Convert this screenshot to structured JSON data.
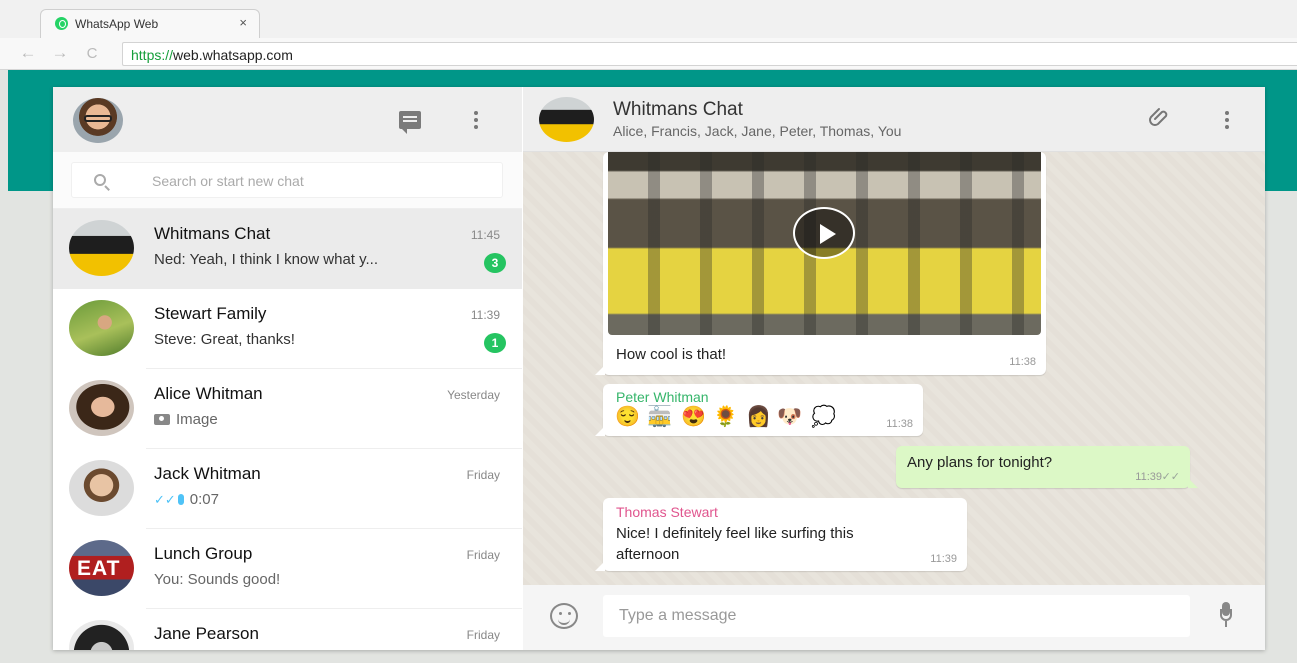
{
  "browser": {
    "tab_title": "WhatsApp Web",
    "tab_close": "×",
    "back_glyph": "←",
    "forward_glyph": "→",
    "reload_glyph": "C",
    "url_scheme": "https://",
    "url_rest": "web.whatsapp.com"
  },
  "search": {
    "placeholder": "Search or start new chat"
  },
  "chats": [
    {
      "name": "Whitmans Chat",
      "time": "11:45",
      "last": "Ned: Yeah, I think I know what y...",
      "unread": "3"
    },
    {
      "name": "Stewart Family",
      "time": "11:39",
      "last": "Steve: Great, thanks!",
      "unread": "1"
    },
    {
      "name": "Alice Whitman",
      "time": "Yesterday",
      "last": "Image"
    },
    {
      "name": "Jack Whitman",
      "time": "Friday",
      "ticks": "✓✓",
      "last": "0:07"
    },
    {
      "name": "Lunch Group",
      "time": "Friday",
      "last": "You: Sounds good!",
      "avatar_text": "EAT"
    },
    {
      "name": "Jane Pearson",
      "time": "Friday"
    }
  ],
  "conversation": {
    "title": "Whitmans Chat",
    "members": "Alice, Francis, Jack, Jane, Peter, Thomas, You"
  },
  "messages": [
    {
      "text": "How cool is that!",
      "time": "11:38"
    },
    {
      "sender": "Peter Whitman",
      "sender_color": "#35b56a",
      "emojis": [
        "😌",
        "🚋",
        "😍",
        "🌻",
        "👩",
        "🐶",
        "💭"
      ],
      "time": "11:38"
    },
    {
      "text": "Any plans for tonight?",
      "time": "11:39",
      "ticks": "✓✓"
    },
    {
      "sender": "Thomas Stewart",
      "sender_color": "#e0558e",
      "line1": "Nice! I definitely feel like surfing this",
      "line2": "afternoon",
      "time": "11:39"
    }
  ],
  "composer": {
    "placeholder": "Type a message"
  },
  "colors": {
    "teal": "#009688",
    "outgoing_bubble": "#dcf8c6",
    "badge": "#25c461"
  }
}
